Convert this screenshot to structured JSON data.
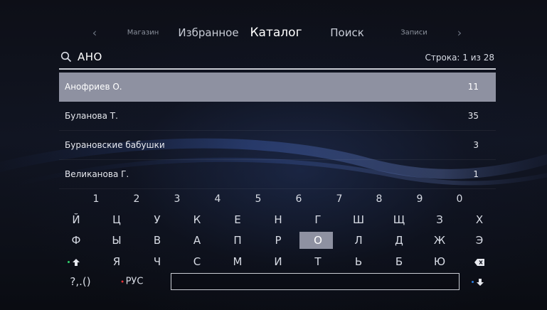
{
  "nav": {
    "items": [
      "Магазин",
      "Избранное",
      "Каталог",
      "Поиск",
      "Записи"
    ],
    "active": "Каталог",
    "prev_arrow": "‹",
    "next_arrow": "›"
  },
  "search": {
    "query": "АНО",
    "row_status": "Строка: 1 из 28"
  },
  "list": {
    "items": [
      {
        "name": "Анофриев О.",
        "count": "11",
        "selected": true
      },
      {
        "name": "Буланова Т.",
        "count": "35"
      },
      {
        "name": "Бурановские бабушки",
        "count": "3"
      },
      {
        "name": "Великанова Г.",
        "count": "1"
      }
    ]
  },
  "keyboard": {
    "digits": [
      "1",
      "2",
      "3",
      "4",
      "5",
      "6",
      "7",
      "8",
      "9",
      "0"
    ],
    "row1": [
      "Й",
      "Ц",
      "У",
      "К",
      "Е",
      "Н",
      "Г",
      "Ш",
      "Щ",
      "З",
      "Х"
    ],
    "row2": [
      "Ф",
      "Ы",
      "В",
      "А",
      "П",
      "Р",
      "О",
      "Л",
      "Д",
      "Ж",
      "Э"
    ],
    "row3": [
      "Я",
      "Ч",
      "С",
      "М",
      "И",
      "Т",
      "Ь",
      "Б",
      "Ю"
    ],
    "highlighted_key": "О",
    "symbols_label": "?,.()",
    "language_label": "РУС",
    "input_value": "",
    "colors": {
      "shift_dot": "#2fd36b",
      "lang_dot": "#e8343a",
      "enter_dot": "#2a7de0",
      "selection": "#8e91a1"
    }
  }
}
